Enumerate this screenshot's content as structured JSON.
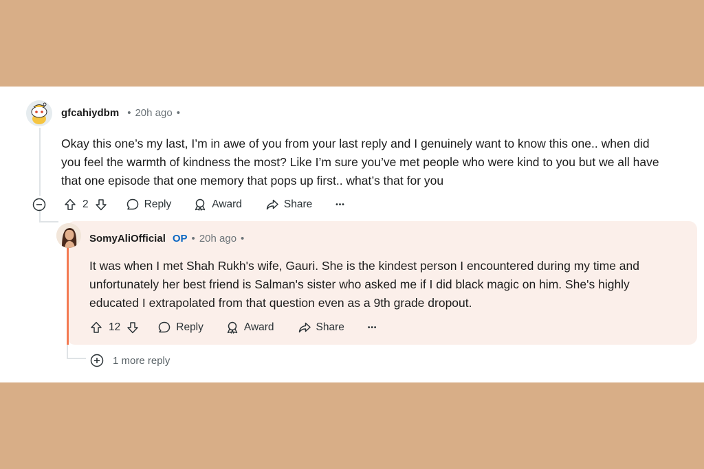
{
  "comment": {
    "username": "gfcahiydbm",
    "separator": "•",
    "time": "20h ago",
    "trailing_dot": "•",
    "body_lines": [
      "Okay this one’s my last, I’m in awe of you from your last reply and I genuinely want to know this one.. when did",
      "you feel the warmth of kindness the most? Like I’m sure you’ve met people who were kind to you but we all have",
      "that one episode that one memory that pops up first.. what’s that for you"
    ],
    "vote_count": "2",
    "reply_label": "Reply",
    "award_label": "Award",
    "share_label": "Share",
    "more_label": "•••"
  },
  "reply": {
    "username": "SomyAliOfficial",
    "op_badge": "OP",
    "separator": "•",
    "time": "20h ago",
    "trailing_dot": "•",
    "body_lines": [
      "It was when I met Shah Rukh's wife, Gauri. She is the kindest person I encountered during my time and",
      "unfortunately her best friend is Salman's sister who asked me if I did black magic on him. She's highly",
      "educated I extrapolated from that question even as a 9th grade dropout."
    ],
    "vote_count": "12",
    "reply_label": "Reply",
    "award_label": "Award",
    "share_label": "Share",
    "more_label": "•••"
  },
  "more_replies": {
    "label": "1 more reply"
  },
  "icons": {
    "collapse": "collapse-minus-icon",
    "upvote": "upvote-arrow-icon",
    "downvote": "downvote-arrow-icon",
    "reply": "speech-bubble-icon",
    "award": "award-ribbon-icon",
    "share": "share-arrow-icon",
    "overflow": "ellipsis-icon",
    "expand": "expand-plus-icon"
  },
  "colors": {
    "background": "#d8ae87",
    "card": "#ffffff",
    "reply_highlight": "#fbefea",
    "reply_accent": "#f37a52",
    "op_badge": "#0a66c2"
  }
}
